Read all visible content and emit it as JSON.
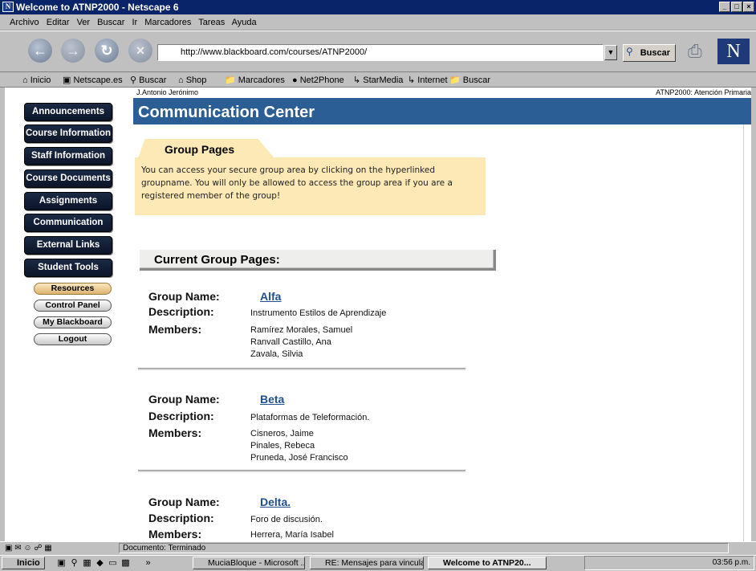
{
  "window": {
    "title": "Welcome to ATNP2000 - Netscape 6",
    "min": "_",
    "max": "□",
    "close": "×"
  },
  "menu": [
    "Archivo",
    "Editar",
    "Ver",
    "Buscar",
    "Ir",
    "Marcadores",
    "Tareas",
    "Ayuda"
  ],
  "toolbar": {
    "url": "http://www.blackboard.com/courses/ATNP2000/",
    "search_label": "Buscar",
    "logo": "N"
  },
  "personal_toolbar": [
    "Inicio",
    "Netscape.es",
    "Buscar",
    "Shop",
    "Marcadores",
    "Net2Phone",
    "StarMedia",
    "Internet",
    "Buscar"
  ],
  "page": {
    "user": "J.Antonio Jerónimo",
    "course": "ATNP2000: Atención Primaria",
    "title": "Communication Center"
  },
  "nav": {
    "main": [
      "Announcements",
      "Course Information",
      "Staff Information",
      "Course Documents",
      "Assignments",
      "Communication",
      "External Links",
      "Student Tools"
    ],
    "small": [
      "Resources",
      "Control Panel",
      "My Blackboard",
      "Logout"
    ]
  },
  "group_pages": {
    "tab": "Group Pages",
    "text": "You can access your secure group area by clicking on the hyperlinked groupname. You will only be allowed to access the group area if you are a registered member of the group!"
  },
  "current": {
    "heading": "Current Group Pages:",
    "labels": {
      "name": "Group Name:",
      "description": "Description:",
      "members": "Members:"
    },
    "groups": [
      {
        "name": "Alfa",
        "description": "Instrumento Estilos de Aprendizaje",
        "members": [
          "Ramírez Morales, Samuel",
          "Ranvall Castillo, Ana",
          "Zavala, Silvia"
        ]
      },
      {
        "name": "Beta",
        "description": "Plataformas de Teleformación.",
        "members": [
          "Cisneros, Jaime",
          "Pinales, Rebeca",
          "Pruneda, José Francisco"
        ]
      },
      {
        "name": "Delta.",
        "description": "Foro de discusión.",
        "members": [
          "Herrera, María Isabel"
        ]
      }
    ]
  },
  "status": {
    "text": "Documento: Terminado"
  },
  "taskbar": {
    "start": "Inicio",
    "items": [
      "MuciaBloque - Microsoft ...",
      "RE: Mensajes para vincula...",
      "Welcome to ATNP20..."
    ],
    "clock": "03:56 p.m."
  }
}
